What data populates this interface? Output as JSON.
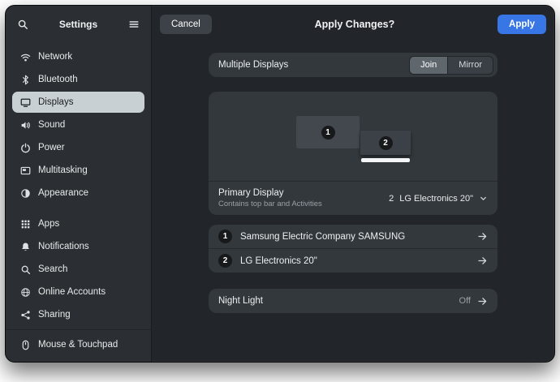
{
  "sidebar": {
    "title": "Settings",
    "items": [
      {
        "label": "Network"
      },
      {
        "label": "Bluetooth"
      },
      {
        "label": "Displays"
      },
      {
        "label": "Sound"
      },
      {
        "label": "Power"
      },
      {
        "label": "Multitasking"
      },
      {
        "label": "Appearance"
      },
      {
        "label": "Apps"
      },
      {
        "label": "Notifications"
      },
      {
        "label": "Search"
      },
      {
        "label": "Online Accounts"
      },
      {
        "label": "Sharing"
      },
      {
        "label": "Mouse & Touchpad"
      }
    ]
  },
  "header": {
    "cancel_label": "Cancel",
    "title": "Apply Changes?",
    "apply_label": "Apply"
  },
  "content": {
    "multiple_displays": {
      "label": "Multiple Displays",
      "join_label": "Join",
      "mirror_label": "Mirror",
      "selected": "Join"
    },
    "arrangement": {
      "display_1_number": "1",
      "display_2_number": "2",
      "selected_display": "2"
    },
    "primary_display": {
      "label": "Primary Display",
      "subtitle": "Contains top bar and Activities",
      "value_number": "2",
      "value_name": "LG Electronics 20\""
    },
    "display_rows": [
      {
        "number": "1",
        "label": "Samsung Electric Company SAMSUNG"
      },
      {
        "number": "2",
        "label": "LG Electronics 20\""
      }
    ],
    "night_light": {
      "label": "Night Light",
      "status": "Off"
    }
  },
  "colors": {
    "accent_blue": "#3776e4",
    "selected_sidebar_row": "#c9d0d3",
    "card_background": "#33383c",
    "window_background": "#222529"
  }
}
